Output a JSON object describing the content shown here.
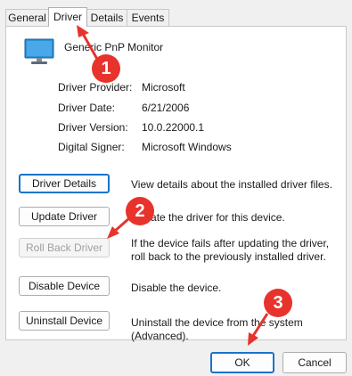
{
  "tabs": [
    "General",
    "Driver",
    "Details",
    "Events"
  ],
  "device_name": "Generic PnP Monitor",
  "info": [
    {
      "label": "Driver Provider:",
      "value": "Microsoft"
    },
    {
      "label": "Driver Date:",
      "value": "6/21/2006"
    },
    {
      "label": "Driver Version:",
      "value": "10.0.22000.1"
    },
    {
      "label": "Digital Signer:",
      "value": "Microsoft Windows"
    }
  ],
  "actions": [
    {
      "button": "Driver Details",
      "description": "View details about the installed driver files."
    },
    {
      "button": "Update Driver",
      "description": "Update the driver for this device."
    },
    {
      "button": "Roll Back Driver",
      "description": "If the device fails after updating the driver, roll back to the previously installed driver."
    },
    {
      "button": "Disable Device",
      "description": "Disable the device."
    },
    {
      "button": "Uninstall Device",
      "description": "Uninstall the device from the system (Advanced)."
    }
  ],
  "footer": {
    "ok": "OK",
    "cancel": "Cancel"
  },
  "annotations": [
    "1",
    "2",
    "3"
  ],
  "colors": {
    "annotation": "#e8322c",
    "focus": "#1a73c8"
  }
}
